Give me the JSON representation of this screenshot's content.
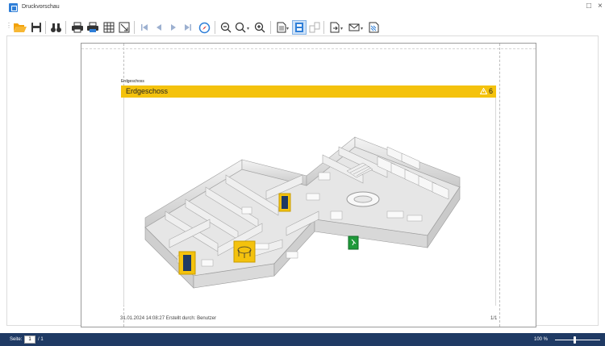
{
  "window": {
    "title": "Druckvorschau",
    "controls": {
      "minimize": "□",
      "close": "×"
    }
  },
  "toolbar": {
    "items": [
      "open-icon",
      "save-icon",
      "find-icon",
      "print-icon",
      "quick-print-icon",
      "page-setup-icon",
      "scale-icon",
      "first-page-icon",
      "previous-page-icon",
      "next-page-icon",
      "last-page-icon",
      "navigation-icon",
      "zoom-out-icon",
      "zoom-icon",
      "zoom-in-icon",
      "page-layout-icon",
      "single-page-icon",
      "multiple-pages-icon",
      "export-icon",
      "send-email-icon",
      "watermark-icon"
    ]
  },
  "document": {
    "floor_caption": "Erdgeschoss",
    "floor_title": "Erdgeschoss",
    "warning_count": "6",
    "footer": "31.01.2024 14:08:27  Erstellt durch: Benutzer",
    "page_number": "1/1"
  },
  "status": {
    "page_label": "Seite:",
    "page_value": "1",
    "page_total": "/ 1",
    "zoom": "100 %"
  },
  "colors": {
    "accent_yellow": "#f4c20d",
    "statusbar": "#1f3a64",
    "toolbar_blue": "#2f7fd8",
    "open_folder": "#f2a20c"
  }
}
